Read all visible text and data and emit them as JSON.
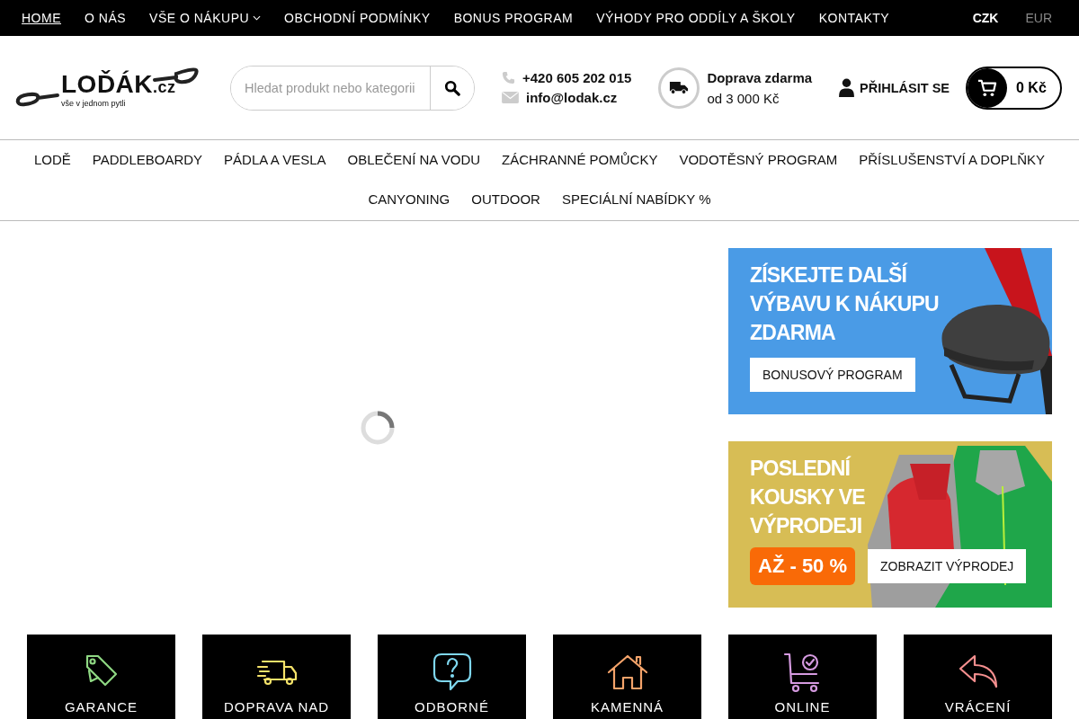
{
  "top_nav": {
    "items": [
      {
        "label": "HOME",
        "selected": true,
        "dropdown": false
      },
      {
        "label": "O NÁS",
        "selected": false,
        "dropdown": false
      },
      {
        "label": "VŠE O NÁKUPU",
        "selected": false,
        "dropdown": true
      },
      {
        "label": "OBCHODNÍ PODMÍNKY",
        "selected": false,
        "dropdown": false
      },
      {
        "label": "BONUS PROGRAM",
        "selected": false,
        "dropdown": false
      },
      {
        "label": "VÝHODY PRO ODDÍLY A ŠKOLY",
        "selected": false,
        "dropdown": false
      },
      {
        "label": "KONTAKTY",
        "selected": false,
        "dropdown": false
      }
    ],
    "currencies": [
      {
        "label": "CZK",
        "selected": true
      },
      {
        "label": "EUR",
        "selected": false
      }
    ]
  },
  "header": {
    "logo": {
      "name": "LOĎÁK",
      "domain": ".cz",
      "tagline": "vše v jednom pytli"
    },
    "search": {
      "placeholder": "Hledat produkt nebo kategorii"
    },
    "phone": "+420 605 202 015",
    "email": "info@lodak.cz",
    "shipping": {
      "title": "Doprava zdarma",
      "subtitle": "od 3 000 Kč"
    },
    "login": "PŘIHLÁSIT SE",
    "cart_total": "0 Kč"
  },
  "categories": [
    "LODĚ",
    "PADDLEBOARDY",
    "PÁDLA A VESLA",
    "OBLEČENÍ NA VODU",
    "ZÁCHRANNÉ POMŮCKY",
    "VODOTĚSNÝ PROGRAM",
    "PŘÍSLUŠENSTVÍ A DOPLŇKY",
    "CANYONING",
    "OUTDOOR",
    "SPECIÁLNÍ NABÍDKY %"
  ],
  "banners": [
    {
      "kind": "bonus",
      "headline": [
        "ZÍSKEJTE DALŠÍ",
        "VÝBAVU K NÁKUPU",
        "ZDARMA"
      ],
      "button": "BONUSOVÝ PROGRAM"
    },
    {
      "kind": "sale",
      "headline": [
        "POSLEDNÍ",
        "KOUSKY VE",
        "VÝPRODEJI"
      ],
      "badge": "AŽ - 50 %",
      "button": "ZOBRAZIT VÝPRODEJ"
    }
  ],
  "features": [
    {
      "kind": "tag",
      "color": "#8fd883",
      "label": "GARANCE"
    },
    {
      "kind": "truck",
      "color": "#f5e36a",
      "label": "DOPRAVA NAD"
    },
    {
      "kind": "question",
      "color": "#7fd8f0",
      "label": "ODBORNÉ"
    },
    {
      "kind": "house",
      "color": "#f4a36a",
      "label": "KAMENNÁ"
    },
    {
      "kind": "cart",
      "color": "#d59ae0",
      "label": "ONLINE"
    },
    {
      "kind": "reply",
      "color": "#f58f8f",
      "label": "VRÁCENÍ"
    }
  ]
}
